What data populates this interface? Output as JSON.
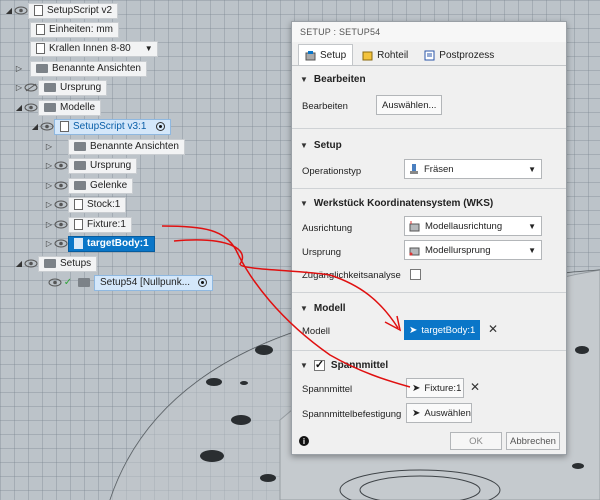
{
  "browser": {
    "root": "SetupScript v2",
    "units": "Einheiten: mm",
    "kralle": "Krallen Innen 8-80",
    "named_views": "Benannte Ansichten",
    "origin": "Ursprung",
    "models": "Modelle",
    "component": "SetupScript v3:1",
    "sub_named_views": "Benannte Ansichten",
    "sub_origin": "Ursprung",
    "joints": "Gelenke",
    "stock": "Stock:1",
    "fixture": "Fixture:1",
    "target": "targetBody:1",
    "setups": "Setups",
    "setup_item": "Setup54 [Nullpunk..."
  },
  "dialog": {
    "title": "SETUP : SETUP54",
    "tabs": [
      "Setup",
      "Rohteil",
      "Postprozess"
    ],
    "bearbeiten": {
      "header": "Bearbeiten",
      "label": "Bearbeiten",
      "button": "Auswählen..."
    },
    "setup": {
      "header": "Setup",
      "op_label": "Operationstyp",
      "op_value": "Fräsen"
    },
    "wks": {
      "header": "Werkstück Koordinatensystem (WKS)",
      "orient_label": "Ausrichtung",
      "orient_value": "Modellausrichtung",
      "origin_label": "Ursprung",
      "origin_value": "Modellursprung",
      "access_label": "Zugänglichkeitsanalyse"
    },
    "modell": {
      "header": "Modell",
      "label": "Modell",
      "value": "targetBody:1"
    },
    "spann": {
      "header": "Spannmittel",
      "label": "Spannmittel",
      "value": "Fixture:1",
      "mount_label": "Spannmittelbefestigung",
      "mount_button": "Auswählen"
    },
    "footer": {
      "ok": "OK",
      "cancel": "Abbrechen"
    }
  },
  "colors": {
    "accent": "#0a76c8",
    "annotation": "#e01010"
  }
}
